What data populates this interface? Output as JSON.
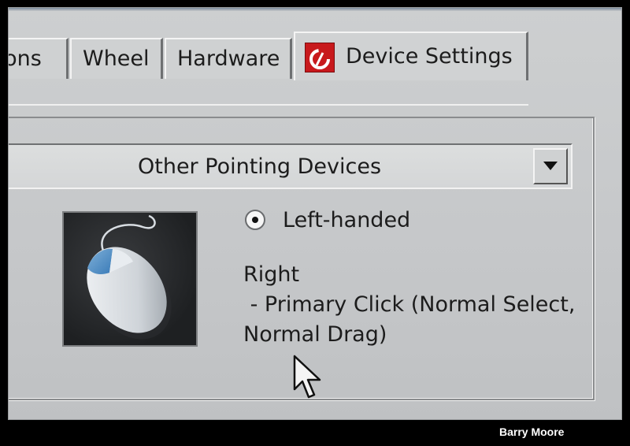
{
  "tabs": [
    {
      "label": "tions"
    },
    {
      "label": "Wheel"
    },
    {
      "label": "Hardware"
    },
    {
      "label": "Device Settings"
    }
  ],
  "device_select": {
    "value": "Other Pointing Devices"
  },
  "radio": {
    "label": "Left-handed",
    "selected": true
  },
  "description": {
    "line1": "Right",
    "line2": " - Primary Click (Normal Select,",
    "line3": "Normal Drag)"
  },
  "credit": "Barry Moore",
  "colors": {
    "brand_red": "#c8191c",
    "panel_gray": "#c6c8ca"
  }
}
